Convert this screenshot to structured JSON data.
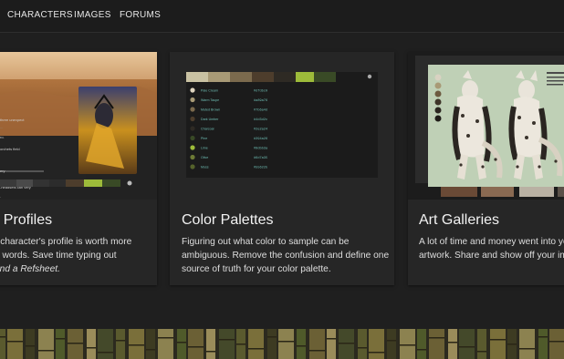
{
  "nav": {
    "items": [
      "CHARACTERS",
      "IMAGES",
      "FORUMS"
    ]
  },
  "cards": [
    {
      "title": "r Profiles",
      "lines": [
        "r character's profile is worth more",
        "d words. Save time typing out"
      ],
      "italic": "end a Refsheet."
    },
    {
      "title": "Color Palettes",
      "lines": [
        "Figuring out what color to sample can be",
        "ambiguous. Remove the confusion and define one",
        "source of truth for your color palette."
      ]
    },
    {
      "title": "Art Galleries",
      "lines": [
        "A lot of time and money went into your",
        "artwork. Share and show off your ima"
      ]
    }
  ],
  "palette_swatches": [
    "#c9c2a3",
    "#a89a76",
    "#7b6a4d",
    "#4d3d2c",
    "#2e2a24",
    "#9dbb3a",
    "#394a26"
  ],
  "palette_rows": [
    {
      "name": "Pale Cream",
      "hex": "#dfd5c0"
    },
    {
      "name": "Warm Taupe",
      "hex": "#a89a76"
    },
    {
      "name": "Muted Brown",
      "hex": "#7b6a4d"
    },
    {
      "name": "Dark Umber",
      "hex": "#4d3d2c"
    },
    {
      "name": "Charcoal",
      "hex": "#2e2a24"
    },
    {
      "name": "Pine",
      "hex": "#394a26"
    },
    {
      "name": "Lime",
      "hex": "#9dbb3a"
    },
    {
      "name": "Olive",
      "hex": "#6d7a35"
    },
    {
      "name": "Moss",
      "hex": "#55622b"
    }
  ],
  "colors": {
    "background": "#1f1f1f",
    "card": "#262626",
    "accent_green": "#9dbb3a",
    "mint_bg": "#bfd0b6"
  }
}
